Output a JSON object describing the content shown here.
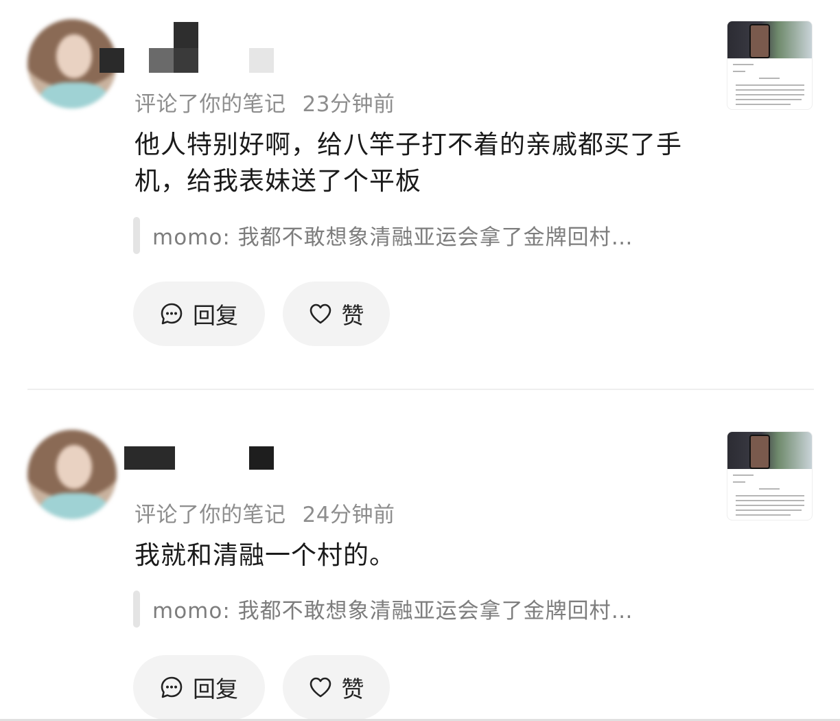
{
  "comments": [
    {
      "action_text": "评论了你的笔记",
      "time": "23分钟前",
      "text": "他人特别好啊，给八竿子打不着的亲戚都买了手机，给我表妹送了个平板",
      "quoted": "momo: 我都不敢想象清融亚运会拿了金牌回村…",
      "reply_label": "回复",
      "like_label": "赞"
    },
    {
      "action_text": "评论了你的笔记",
      "time": "24分钟前",
      "text": "我就和清融一个村的。",
      "quoted": "momo: 我都不敢想象清融亚运会拿了金牌回村…",
      "reply_label": "回复",
      "like_label": "赞"
    }
  ],
  "icons": {
    "reply": "chat-bubble-icon",
    "like": "heart-outline-icon"
  },
  "colors": {
    "meta_text": "#8d8d8d",
    "body_text": "#1a1a1a",
    "button_bg": "#f3f3f3",
    "quote_bar": "#e4e4e4"
  }
}
